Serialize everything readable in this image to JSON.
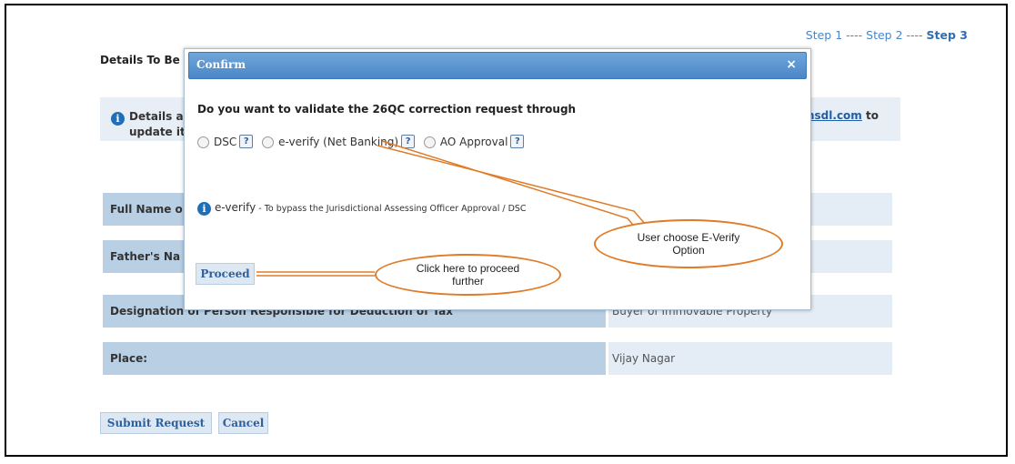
{
  "steps": {
    "s1": "Step 1",
    "sep1": " ---- ",
    "s2": "Step 2",
    "sep2": " ---- ",
    "s3": "Step 3"
  },
  "section_title_partial": "Details To Be",
  "info_bar": {
    "line1_partial": "Details a",
    "line2_partial": "update it",
    "link_partial": "nsdl.com",
    "after_link": " to"
  },
  "form_rows": [
    {
      "label": "Full Name o",
      "value": ""
    },
    {
      "label": "Father's Na",
      "value": ""
    },
    {
      "label": "Designation of Person Responsible for Deduction of Tax",
      "value": "Buyer of Immovable Property"
    },
    {
      "label": "Place:",
      "value": "Vijay Nagar"
    }
  ],
  "buttons": {
    "submit": "Submit Request",
    "cancel": "Cancel"
  },
  "modal": {
    "title": "Confirm",
    "close": "×",
    "question": "Do you want to validate the 26QC correction request through",
    "options": [
      {
        "label": "DSC",
        "selected": false
      },
      {
        "label": "e-verify (Net Banking)",
        "selected": false
      },
      {
        "label": "AO Approval",
        "selected": false
      }
    ],
    "help_glyph": "?",
    "note_term": "e-verify",
    "note_text": " - To bypass the Jurisdictional Assessing Officer Approval / DSC",
    "proceed": "Proceed"
  },
  "callouts": {
    "everify": "User choose  E-Verify Option",
    "proceed": "Click here to proceed further"
  },
  "colors": {
    "accent": "#4b87c7",
    "callout_border": "#e07b28",
    "label_cell": "#b9cfe4",
    "value_cell": "#e4ecf5"
  }
}
